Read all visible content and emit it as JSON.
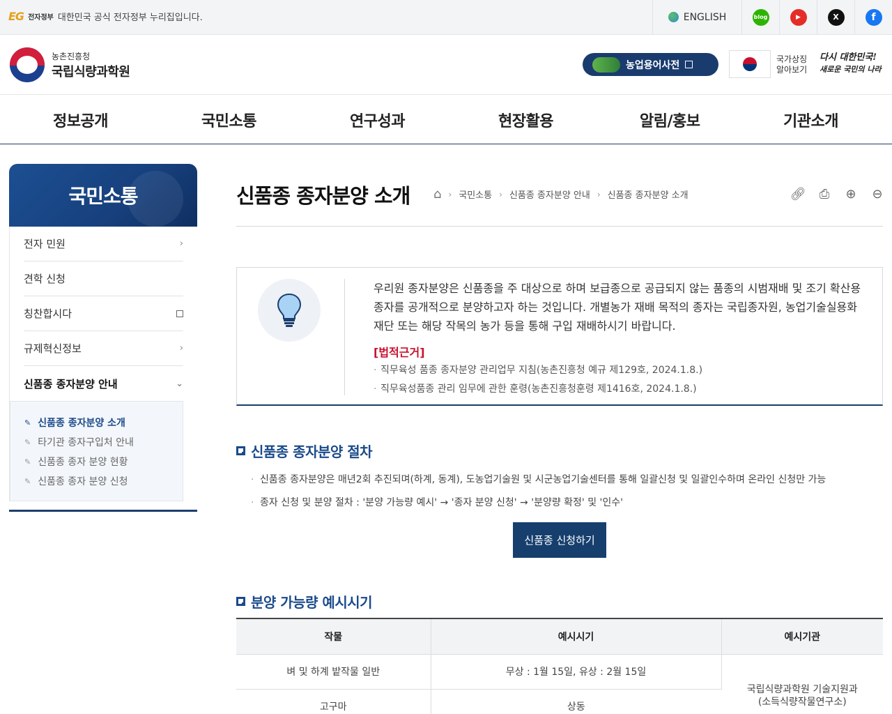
{
  "gov_bar": {
    "eg_logo": "EG",
    "gov_label": "전자정부",
    "notice": "대한민국 공식 전자정부 누리집입니다.",
    "english": "ENGLISH",
    "social": [
      {
        "name": "blog",
        "glyph": "blog",
        "color": "#2db400"
      },
      {
        "name": "youtube",
        "glyph": "▶",
        "color": "#e52d27"
      },
      {
        "name": "x",
        "glyph": "X",
        "color": "#111111"
      },
      {
        "name": "facebook",
        "glyph": "f",
        "color": "#1877f2"
      }
    ]
  },
  "header": {
    "org_sub": "농촌진흥청",
    "org_name": "국립식량과학원",
    "dict_button": "농업용어사전",
    "symbol_label_1": "국가상징",
    "symbol_label_2": "알아보기",
    "slogan_1": "다시 대한민국!",
    "slogan_2": "새로운 국민의 나라"
  },
  "nav": [
    "정보공개",
    "국민소통",
    "연구성과",
    "현장활용",
    "알림/홍보",
    "기관소개"
  ],
  "sidebar": {
    "title": "국민소통",
    "items": [
      {
        "label": "전자 민원",
        "icon": "›"
      },
      {
        "label": "견학 신청",
        "icon": ""
      },
      {
        "label": "칭찬합시다",
        "icon": "external"
      },
      {
        "label": "규제혁신정보",
        "icon": "›"
      },
      {
        "label": "신품종 종자분양 안내",
        "icon": "⌄"
      }
    ],
    "sub_items": [
      "신품종 종자분양 소개",
      "타기관 종자구입처 안내",
      "신품종 종자 분양 현황",
      "신품종 종자 분양 신청"
    ]
  },
  "page": {
    "title": "신품종 종자분양 소개",
    "breadcrumb": [
      "국민소통",
      "신품종 종자분양 안내",
      "신품종 종자분양 소개"
    ]
  },
  "info": {
    "text": "우리원 종자분양은 신품종을 주 대상으로 하며 보급종으로 공급되지 않는 품종의 시범재배 및 조기 확산용 종자를 공개적으로 분양하고자 하는 것입니다. 개별농가 재배 목적의 종자는 국립종자원, 농업기술실용화재단 또는 해당 작목의 농가 등을 통해 구입 재배하시기 바랍니다.",
    "legal_head": "[법적근거]",
    "legal": [
      "직무육성 품종 종자분양 관리업무 지침(농촌진흥청 예규 제129호, 2024.1.8.)",
      "직무육성품종 관리 임무에 관한 훈령(농촌진흥청훈령 제1416호, 2024.1.8.)"
    ]
  },
  "procedure": {
    "title": "신품종 종자분양 절차",
    "bullets": [
      "신품종 종자분양은 매년2회 추진되며(하계, 동계), 도농업기술원 및 시군농업기술센터를 통해 일괄신청 및 일괄인수하며 온라인 신청만 가능",
      "종자 신청 및 분양 절차 : '분양 가능량 예시' → '종자 분양 신청' → '분양량 확정' 및 '인수'"
    ],
    "apply_button": "신품종 신청하기"
  },
  "schedule": {
    "title": "분양 가능량 예시시기",
    "headers": [
      "작물",
      "예시시기",
      "예시기관"
    ],
    "rows": [
      {
        "crop": "벼 및 하계 밭작물 일반",
        "period": "무상 : 1월 15일, 유상 : 2월 15일"
      },
      {
        "crop": "고구마",
        "period": "상동"
      }
    ],
    "org_1": "국립식량과학원 기술지원과",
    "org_2": "(소득식량작물연구소)"
  }
}
